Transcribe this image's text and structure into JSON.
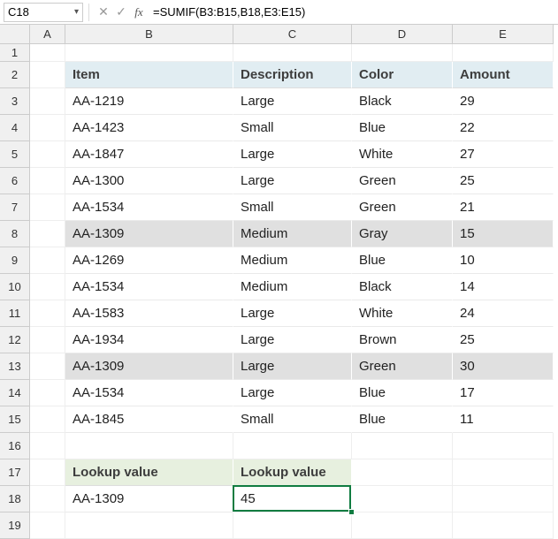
{
  "formula_bar": {
    "name_box": "C18",
    "formula": "=SUMIF(B3:B15,B18,E3:E15)"
  },
  "columns": [
    "A",
    "B",
    "C",
    "D",
    "E"
  ],
  "row_numbers": [
    1,
    2,
    3,
    4,
    5,
    6,
    7,
    8,
    9,
    10,
    11,
    12,
    13,
    14,
    15,
    16,
    17,
    18,
    19
  ],
  "table": {
    "headers": {
      "item": "Item",
      "description": "Description",
      "color": "Color",
      "amount": "Amount"
    },
    "rows": [
      {
        "item": "AA-1219",
        "description": "Large",
        "color": "Black",
        "amount": "29",
        "hl": false
      },
      {
        "item": "AA-1423",
        "description": "Small",
        "color": "Blue",
        "amount": "22",
        "hl": false
      },
      {
        "item": "AA-1847",
        "description": "Large",
        "color": "White",
        "amount": "27",
        "hl": false
      },
      {
        "item": "AA-1300",
        "description": "Large",
        "color": "Green",
        "amount": "25",
        "hl": false
      },
      {
        "item": "AA-1534",
        "description": "Small",
        "color": "Green",
        "amount": "21",
        "hl": false
      },
      {
        "item": "AA-1309",
        "description": "Medium",
        "color": "Gray",
        "amount": "15",
        "hl": true
      },
      {
        "item": "AA-1269",
        "description": "Medium",
        "color": "Blue",
        "amount": "10",
        "hl": false
      },
      {
        "item": "AA-1534",
        "description": "Medium",
        "color": "Black",
        "amount": "14",
        "hl": false
      },
      {
        "item": "AA-1583",
        "description": "Large",
        "color": "White",
        "amount": "24",
        "hl": false
      },
      {
        "item": "AA-1934",
        "description": "Large",
        "color": "Brown",
        "amount": "25",
        "hl": false
      },
      {
        "item": "AA-1309",
        "description": "Large",
        "color": "Green",
        "amount": "30",
        "hl": true
      },
      {
        "item": "AA-1534",
        "description": "Large",
        "color": "Blue",
        "amount": "17",
        "hl": false
      },
      {
        "item": "AA-1845",
        "description": "Small",
        "color": "Blue",
        "amount": "11",
        "hl": false
      }
    ]
  },
  "lookup": {
    "header1": "Lookup value",
    "header2": "Lookup value",
    "value": "AA-1309",
    "result": "45"
  },
  "active_cell": "C18"
}
